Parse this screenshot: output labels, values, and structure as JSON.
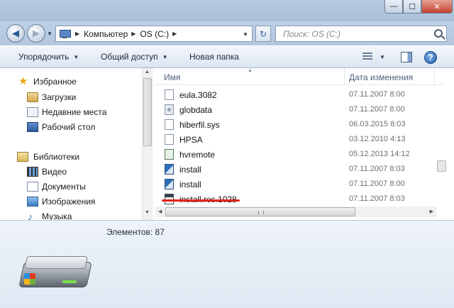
{
  "window": {
    "title_controls": {
      "minimize": "—",
      "maximize": "☐",
      "close": "✕"
    }
  },
  "address": {
    "breadcrumbs": [
      "Компьютер",
      "OS (C:)"
    ],
    "search_placeholder": "Поиск: OS (C:)"
  },
  "toolbar": {
    "organize_label": "Упорядочить",
    "share_label": "Общий доступ",
    "new_folder_label": "Новая папка",
    "help_label": "?"
  },
  "sidebar": {
    "favorites": {
      "label": "Избранное",
      "items": [
        {
          "label": "Загрузки",
          "icon": "downloads-icon"
        },
        {
          "label": "Недавние места",
          "icon": "recent-places-icon"
        },
        {
          "label": "Рабочий стол",
          "icon": "desktop-icon"
        }
      ]
    },
    "libraries": {
      "label": "Библиотеки",
      "items": [
        {
          "label": "Видео",
          "icon": "video-icon"
        },
        {
          "label": "Документы",
          "icon": "documents-icon"
        },
        {
          "label": "Изображения",
          "icon": "images-icon"
        },
        {
          "label": "Музыка",
          "icon": "music-icon"
        }
      ]
    }
  },
  "files": {
    "columns": {
      "name": "Имя",
      "date": "Дата изменения"
    },
    "rows": [
      {
        "name": "eula.3082",
        "date": "07.11.2007 8:00",
        "icon": "text-file-icon",
        "trunc": ""
      },
      {
        "name": "globdata",
        "date": "07.11.2007 8:00",
        "icon": "config-file-icon",
        "trunc": ""
      },
      {
        "name": "hiberfil.sys",
        "date": "06.03.2015 8:03",
        "icon": "system-file-icon",
        "trunc": ""
      },
      {
        "name": "HPSA",
        "date": "03.12.2010 4:13",
        "icon": "blank-file-icon",
        "trunc": ""
      },
      {
        "name": "hvremote",
        "date": "05.12.2013 14:12",
        "icon": "script-file-icon",
        "trunc": ""
      },
      {
        "name": "install",
        "date": "07.11.2007 8:03",
        "icon": "setup-file-icon",
        "trunc": ""
      },
      {
        "name": "install",
        "date": "07.11.2007 8:00",
        "icon": "setup-file-icon",
        "trunc": ""
      },
      {
        "name": "install.res.1028",
        "date": "07.11.2007 8:03",
        "icon": "resource-file-icon",
        "trunc": ""
      }
    ],
    "highlight_color": "#e2231a"
  },
  "details": {
    "item_count": "Элементов: 87"
  }
}
